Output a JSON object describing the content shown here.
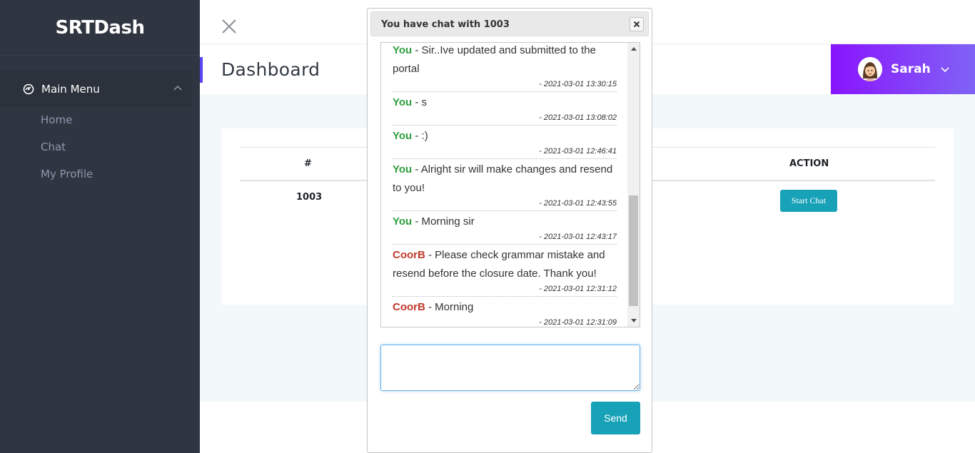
{
  "sidebar": {
    "brand": "SRTDash",
    "menu_title": "Main Menu",
    "items": [
      {
        "label": "Home"
      },
      {
        "label": "Chat"
      },
      {
        "label": "My Profile"
      }
    ]
  },
  "header": {
    "page_title": "Dashboard",
    "user_name": "Sarah"
  },
  "table": {
    "headers": [
      "#",
      "ACTION"
    ],
    "rows": [
      {
        "id": "1003",
        "action_label": "Start Chat"
      }
    ]
  },
  "dialog": {
    "title": "You have chat with 1003",
    "messages": [
      {
        "sender": "You",
        "text": " - Sir..Ive updated and submitted to the portal",
        "time": "- 2021-03-01 13:30:15"
      },
      {
        "sender": "You",
        "text": " - s",
        "time": "- 2021-03-01 13:08:02"
      },
      {
        "sender": "You",
        "text": " - :)",
        "time": "- 2021-03-01 12:46:41"
      },
      {
        "sender": "You",
        "text": " - Alright sir will make changes and resend to you!",
        "time": "- 2021-03-01 12:43:55"
      },
      {
        "sender": "You",
        "text": " - Morning sir",
        "time": "- 2021-03-01 12:43:17"
      },
      {
        "sender": "CoorB",
        "text": " - Please check grammar mistake and resend before the closure date. Thank you!",
        "time": "- 2021-03-01 12:31:12"
      },
      {
        "sender": "CoorB",
        "text": " - Morning",
        "time": "- 2021-03-01 12:31:09"
      }
    ],
    "input_value": "",
    "send_label": "Send"
  },
  "colors": {
    "sidebar_bg": "#303641",
    "accent_purple": "#8914fe",
    "teal_button": "#17a2b8",
    "you_green": "#2e9e3e",
    "coor_red": "#c0392b"
  }
}
